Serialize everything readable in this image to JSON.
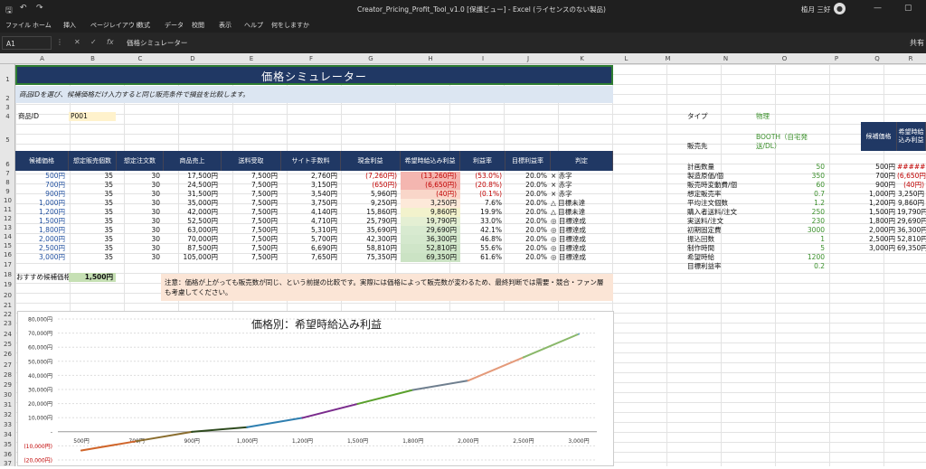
{
  "window": {
    "title": "Creator_Pricing_Profit_Tool_v1.0 [保護ビュー] - Excel (ライセンスのない製品)",
    "user": "植月 三好",
    "avatar_initial": "👤"
  },
  "ribbon_tabs": [
    "ファイル",
    "ホーム",
    "挿入",
    "ページレイアウト",
    "数式",
    "データ",
    "校閲",
    "表示",
    "ヘルプ",
    "何をしますか"
  ],
  "ribbon_right": "共有",
  "formula_bar": {
    "cell": "A1",
    "content": "価格シミュレーター",
    "fx": "fx"
  },
  "columns": [
    "A",
    "B",
    "C",
    "D",
    "E",
    "F",
    "G",
    "H",
    "I",
    "J",
    "K",
    "L",
    "M",
    "N",
    "O",
    "P",
    "Q",
    "R"
  ],
  "rows": [
    "1",
    "2",
    "3",
    "4",
    "5",
    "6",
    "7",
    "8",
    "9",
    "10",
    "11",
    "12",
    "13",
    "14",
    "15",
    "16",
    "17",
    "18",
    "19",
    "20",
    "21",
    "22",
    "23",
    "24",
    "25",
    "26",
    "27",
    "28",
    "29",
    "30",
    "31",
    "32",
    "33",
    "34",
    "35",
    "36",
    "37"
  ],
  "sheet": {
    "title": "価格シミュレーター",
    "subtitle": "商品IDを選び、候補価格だけ入力すると同じ販売条件で損益を比較します。",
    "product_id_label": "商品ID",
    "product_id": "P001",
    "headers": [
      "候補価格",
      "想定販売個数",
      "想定注文数",
      "商品売上",
      "送料受取",
      "サイト手数料",
      "現金利益",
      "希望時給込み利益",
      "利益率",
      "目標利益率",
      "判定"
    ],
    "table": [
      [
        "500円",
        "35",
        "30",
        "17,500円",
        "7,500円",
        "2,760円",
        "(7,260円)",
        "(13,260円)",
        "(53.0%)",
        "20.0%",
        "× 赤字"
      ],
      [
        "700円",
        "35",
        "30",
        "24,500円",
        "7,500円",
        "3,150円",
        "(650円)",
        "(6,650円)",
        "(20.8%)",
        "20.0%",
        "× 赤字"
      ],
      [
        "900円",
        "35",
        "30",
        "31,500円",
        "7,500円",
        "3,540円",
        "5,960円",
        "(40円)",
        "(0.1%)",
        "20.0%",
        "× 赤字"
      ],
      [
        "1,000円",
        "35",
        "30",
        "35,000円",
        "7,500円",
        "3,750円",
        "9,250円",
        "3,250円",
        "7.6%",
        "20.0%",
        "△ 目標未達"
      ],
      [
        "1,200円",
        "35",
        "30",
        "42,000円",
        "7,500円",
        "4,140円",
        "15,860円",
        "9,860円",
        "19.9%",
        "20.0%",
        "△ 目標未達"
      ],
      [
        "1,500円",
        "35",
        "30",
        "52,500円",
        "7,500円",
        "4,710円",
        "25,790円",
        "19,790円",
        "33.0%",
        "20.0%",
        "◎ 目標達成"
      ],
      [
        "1,800円",
        "35",
        "30",
        "63,000円",
        "7,500円",
        "5,310円",
        "35,690円",
        "29,690円",
        "42.1%",
        "20.0%",
        "◎ 目標達成"
      ],
      [
        "2,000円",
        "35",
        "30",
        "70,000円",
        "7,500円",
        "5,700円",
        "42,300円",
        "36,300円",
        "46.8%",
        "20.0%",
        "◎ 目標達成"
      ],
      [
        "2,500円",
        "35",
        "30",
        "87,500円",
        "7,500円",
        "6,690円",
        "58,810円",
        "52,810円",
        "55.6%",
        "20.0%",
        "◎ 目標達成"
      ],
      [
        "3,000円",
        "35",
        "30",
        "105,000円",
        "7,500円",
        "7,650円",
        "75,350円",
        "69,350円",
        "61.6%",
        "20.0%",
        "◎ 目標達成"
      ]
    ],
    "recommend_label": "おすすめ候補価格",
    "recommend_value": "1,500円",
    "note": "注意：価格が上がっても販売数が同じ、という前提の比較です。実際には価格によって販売数が変わるため、最終判断では需要・競合・ファン層も考慮してください。",
    "side": {
      "type_label": "タイプ",
      "type_value": "物理",
      "channel_label": "販売先",
      "channel_value": "BOOTH（自宅発送/DL）",
      "params": [
        [
          "計画数量",
          "50"
        ],
        [
          "製造原価/個",
          "350"
        ],
        [
          "販売時変動費/個",
          "60"
        ],
        [
          "想定販売率",
          "0.7"
        ],
        [
          "平均注文個数",
          "1.2"
        ],
        [
          "購入者送料/注文",
          "250"
        ],
        [
          "実送料/注文",
          "230"
        ],
        [
          "初期固定費",
          "3000"
        ],
        [
          "振込回数",
          "1"
        ],
        [
          "制作時間",
          "5"
        ],
        [
          "希望時給",
          "1200"
        ],
        [
          "目標利益率",
          "0.2"
        ]
      ]
    },
    "mini": {
      "headers": [
        "候補価格",
        "希望時給込み利益"
      ],
      "rows": [
        [
          "500円",
          "########"
        ],
        [
          "700円",
          "(6,650円)"
        ],
        [
          "900円",
          "(40円)"
        ],
        [
          "1,000円",
          "3,250円"
        ],
        [
          "1,200円",
          "9,860円"
        ],
        [
          "1,500円",
          "19,790円"
        ],
        [
          "1,800円",
          "29,690円"
        ],
        [
          "2,000円",
          "36,300円"
        ],
        [
          "2,500円",
          "52,810円"
        ],
        [
          "3,000円",
          "69,350円"
        ]
      ]
    }
  },
  "chart_data": {
    "type": "line",
    "title": "価格別：希望時給込み利益",
    "categories": [
      "500円",
      "700円",
      "900円",
      "1,000円",
      "1,200円",
      "1,500円",
      "1,800円",
      "2,000円",
      "2,500円",
      "3,000円"
    ],
    "series": [
      {
        "values": [
          -13260,
          -6650,
          -40,
          3250,
          9860,
          19790,
          29690,
          36300,
          52810,
          69350
        ]
      }
    ],
    "y_ticks": [
      "80,000円",
      "70,000円",
      "60,000円",
      "50,000円",
      "40,000円",
      "30,000円",
      "20,000円",
      "10,000円",
      "-",
      "(10,000円)",
      "(20,000円)"
    ],
    "ylim": [
      -20000,
      80000
    ],
    "grid": true,
    "colors": [
      "#d0652a",
      "#8a6d2e",
      "#2e4a1e",
      "#2f7fb0",
      "#7a2b8c",
      "#5aa02c",
      "#6f7f8f",
      "#e49a7a",
      "#8ab86a",
      "#6fa8d6"
    ]
  }
}
